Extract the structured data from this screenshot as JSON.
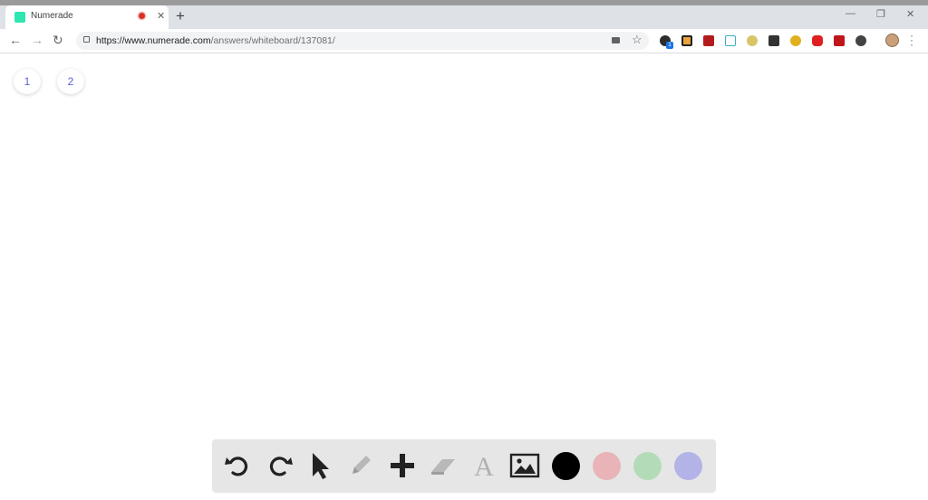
{
  "browser": {
    "tab_title": "Numerade",
    "new_tab_glyph": "+",
    "url_host": "https://www.numerade.com",
    "url_path": "/answers/whiteboard/137081/",
    "extension_badge": "1"
  },
  "whiteboard": {
    "pages": [
      "1",
      "2"
    ],
    "page_color": "#5a5fd0",
    "tools": [
      {
        "name": "undo-icon"
      },
      {
        "name": "redo-icon"
      },
      {
        "name": "pointer-icon"
      },
      {
        "name": "pencil-icon"
      },
      {
        "name": "plus-icon"
      },
      {
        "name": "eraser-icon"
      },
      {
        "name": "text-icon",
        "glyph": "A"
      },
      {
        "name": "image-icon"
      }
    ],
    "colors": [
      "#000000",
      "#e8b4b8",
      "#b4dbb8",
      "#b3b3e8"
    ]
  }
}
